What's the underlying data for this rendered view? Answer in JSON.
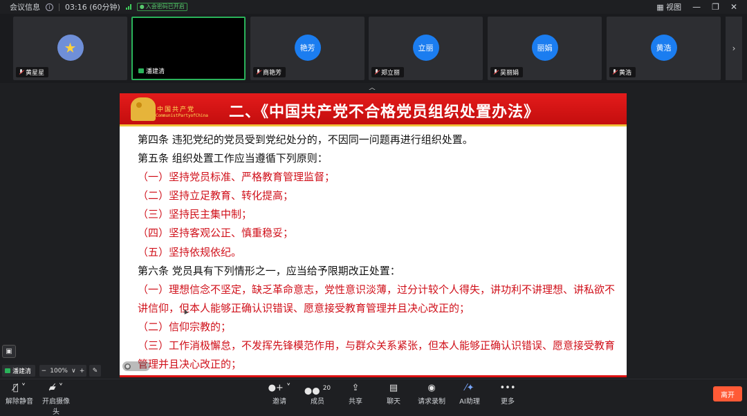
{
  "topbar": {
    "meeting_info": "会议信息",
    "duration": "03:16 (60分钟)",
    "entry_badge": "入会密码已开启",
    "view_label": "视图"
  },
  "participants": [
    {
      "name": "黄星星",
      "avatar_text": "",
      "mic_muted": true
    },
    {
      "name": "潘建清",
      "avatar_text": "",
      "sharing": true
    },
    {
      "name": "商艳芳",
      "avatar_text": "艳芳",
      "mic_muted": true
    },
    {
      "name": "郑立丽",
      "avatar_text": "立丽",
      "mic_muted": true
    },
    {
      "name": "吴丽娟",
      "avatar_text": "丽娟",
      "mic_muted": true
    },
    {
      "name": "黄浩",
      "avatar_text": "黄浩",
      "mic_muted": true
    }
  ],
  "slide": {
    "party_cn": "中国共产党",
    "party_en": "CommunistPartyofChina",
    "title": "二、《中国共产党不合格党员组织处置办法》",
    "lines": [
      {
        "text": "第四条  违犯党纪的党员受到党纪处分的，不因同一问题再进行组织处置。",
        "color": "black"
      },
      {
        "text": "第五条  组织处置工作应当遵循下列原则：",
        "color": "black"
      },
      {
        "text": "（一）坚持党员标准、严格教育管理监督；",
        "color": "red"
      },
      {
        "text": "（二）坚持立足教育、转化提高；",
        "color": "red"
      },
      {
        "text": "（三）坚持民主集中制；",
        "color": "red"
      },
      {
        "text": "（四）坚持客观公正、慎重稳妥；",
        "color": "red"
      },
      {
        "text": "（五）坚持依规依纪。",
        "color": "red"
      },
      {
        "text": "第六条  党员具有下列情形之一，应当给予限期改正处置：",
        "color": "black"
      },
      {
        "text": "（一）理想信念不坚定，缺乏革命意志，党性意识淡薄，过分计较个人得失，讲功利不讲理想、讲私欲不讲信仰，但本人能够正确认识错误、愿意接受教育管理并且决心改正的；",
        "color": "red"
      },
      {
        "text": "（二）信仰宗教的；",
        "color": "red"
      },
      {
        "text": "（三）工作消极懈怠，不发挥先锋模范作用，与群众关系紧张，但本人能够正确认识错误、愿意接受教育管理并且决心改正的；",
        "color": "red"
      }
    ]
  },
  "self_view": {
    "name": "潘建清",
    "zoom": "100%"
  },
  "toolbar": {
    "unmute": "解除静音",
    "start_video": "开启摄像头",
    "invite": "邀请",
    "members": "成员",
    "member_count": "20",
    "share": "共享",
    "chat": "聊天",
    "record": "请求录制",
    "ai": "AI助理",
    "more": "更多",
    "leave": "离开"
  },
  "colors": {
    "accent_green": "#2ab35a",
    "avatar_blue": "#1b7df0",
    "slide_red": "#d0101a",
    "leave_orange": "#ff5a36"
  }
}
